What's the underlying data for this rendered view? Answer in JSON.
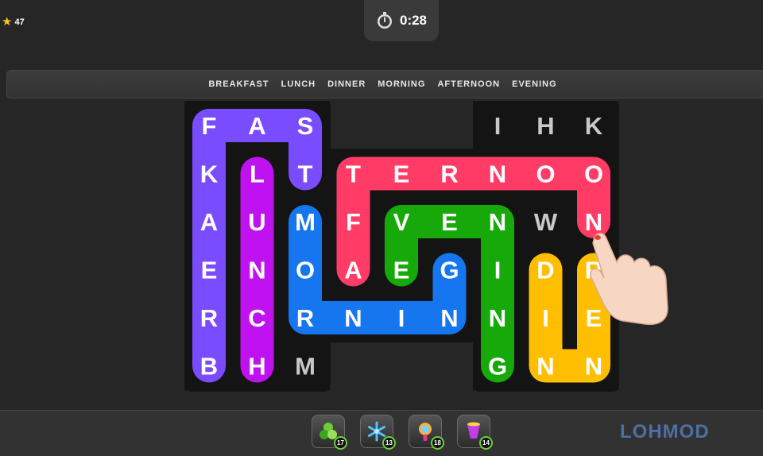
{
  "hud": {
    "coins": "47",
    "timer": "0:28"
  },
  "words": [
    "BREAKFAST",
    "LUNCH",
    "DINNER",
    "MORNING",
    "AFTERNOON",
    "EVENING"
  ],
  "grid": {
    "rows": [
      [
        "F",
        "A",
        "S",
        "",
        "",
        "",
        "I",
        "H",
        "K"
      ],
      [
        "K",
        "L",
        "T",
        "T",
        "E",
        "R",
        "N",
        "O",
        "O"
      ],
      [
        "A",
        "U",
        "M",
        "F",
        "V",
        "E",
        "N",
        "W",
        "N"
      ],
      [
        "E",
        "N",
        "O",
        "A",
        "E",
        "G",
        "I",
        "D",
        "R"
      ],
      [
        "R",
        "C",
        "R",
        "N",
        "I",
        "N",
        "N",
        "I",
        "E"
      ],
      [
        "B",
        "H",
        "M",
        "",
        "",
        "",
        "G",
        "N",
        "N"
      ]
    ]
  },
  "paths": [
    {
      "word": "BREAKFAST",
      "color": "#7a4cff",
      "cells": [
        [
          5,
          0
        ],
        [
          4,
          0
        ],
        [
          3,
          0
        ],
        [
          2,
          0
        ],
        [
          1,
          0
        ],
        [
          0,
          0
        ],
        [
          0,
          1
        ],
        [
          0,
          2
        ],
        [
          1,
          2
        ]
      ]
    },
    {
      "word": "LUNCH",
      "color": "#c012f0",
      "cells": [
        [
          1,
          1
        ],
        [
          2,
          1
        ],
        [
          3,
          1
        ],
        [
          4,
          1
        ],
        [
          5,
          1
        ]
      ]
    },
    {
      "word": "MORNING",
      "color": "#1576f0",
      "cells": [
        [
          2,
          2
        ],
        [
          3,
          2
        ],
        [
          4,
          2
        ],
        [
          4,
          3
        ],
        [
          4,
          4
        ],
        [
          4,
          5
        ],
        [
          3,
          5
        ]
      ]
    },
    {
      "word": "AFTERNOON",
      "color": "#ff3b66",
      "cells": [
        [
          3,
          3
        ],
        [
          2,
          3
        ],
        [
          1,
          3
        ],
        [
          1,
          4
        ],
        [
          1,
          5
        ],
        [
          1,
          6
        ],
        [
          1,
          7
        ],
        [
          1,
          8
        ],
        [
          2,
          8
        ]
      ]
    },
    {
      "word": "EVENING",
      "color": "#17a80a",
      "cells": [
        [
          3,
          4
        ],
        [
          2,
          4
        ],
        [
          2,
          5
        ],
        [
          2,
          6
        ],
        [
          3,
          6
        ],
        [
          4,
          6
        ],
        [
          5,
          6
        ]
      ]
    },
    {
      "word": "DINNER",
      "color": "#ffbf00",
      "cells": [
        [
          3,
          7
        ],
        [
          4,
          7
        ],
        [
          5,
          7
        ],
        [
          5,
          8
        ],
        [
          4,
          8
        ],
        [
          3,
          8
        ]
      ]
    }
  ],
  "boosters": [
    {
      "icon": "paint-blobs-icon",
      "count": "17"
    },
    {
      "icon": "snowflake-icon",
      "count": "13"
    },
    {
      "icon": "magnifier-icon",
      "count": "18"
    },
    {
      "icon": "magic-cup-icon",
      "count": "14"
    }
  ],
  "brand": "LOHMOD"
}
